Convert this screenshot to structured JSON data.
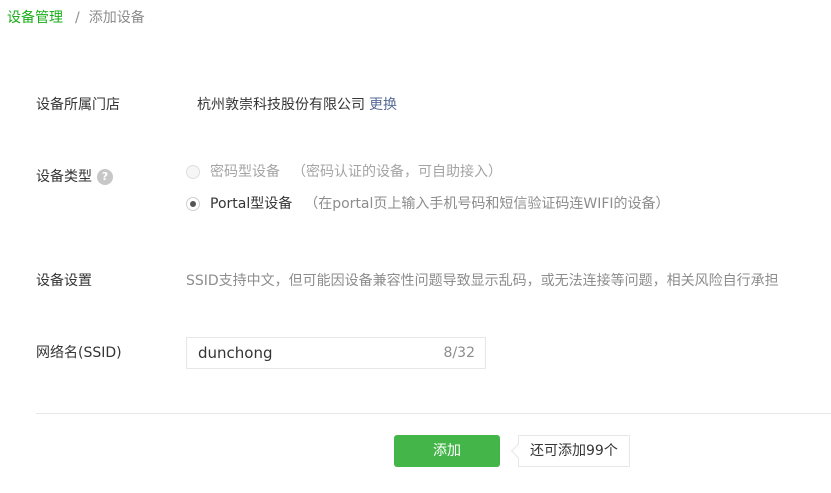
{
  "breadcrumb": {
    "parent": "设备管理",
    "separator": "/",
    "current": "添加设备"
  },
  "store": {
    "label": "设备所属门店",
    "name": "杭州敦崇科技股份有限公司",
    "change_link": "更换"
  },
  "device_type": {
    "label": "设备类型",
    "help_icon": "?",
    "options": [
      {
        "label": "密码型设备",
        "description": "（密码认证的设备，可自助接入）",
        "selected": false,
        "disabled": true
      },
      {
        "label": "Portal型设备",
        "description": "（在portal页上输入手机号码和短信验证码连WIFI的设备）",
        "selected": true,
        "disabled": false
      }
    ]
  },
  "device_settings": {
    "label": "设备设置",
    "note": "SSID支持中文，但可能因设备兼容性问题导致显示乱码，或无法连接等问题，相关风险自行承担"
  },
  "ssid": {
    "label": "网络名(SSID)",
    "value": "dunchong",
    "counter": "8/32"
  },
  "actions": {
    "add_label": "添加",
    "remaining": "还可添加99个"
  },
  "colors": {
    "accent": "#1aad19",
    "button": "#44b549",
    "link": "#576b95"
  }
}
